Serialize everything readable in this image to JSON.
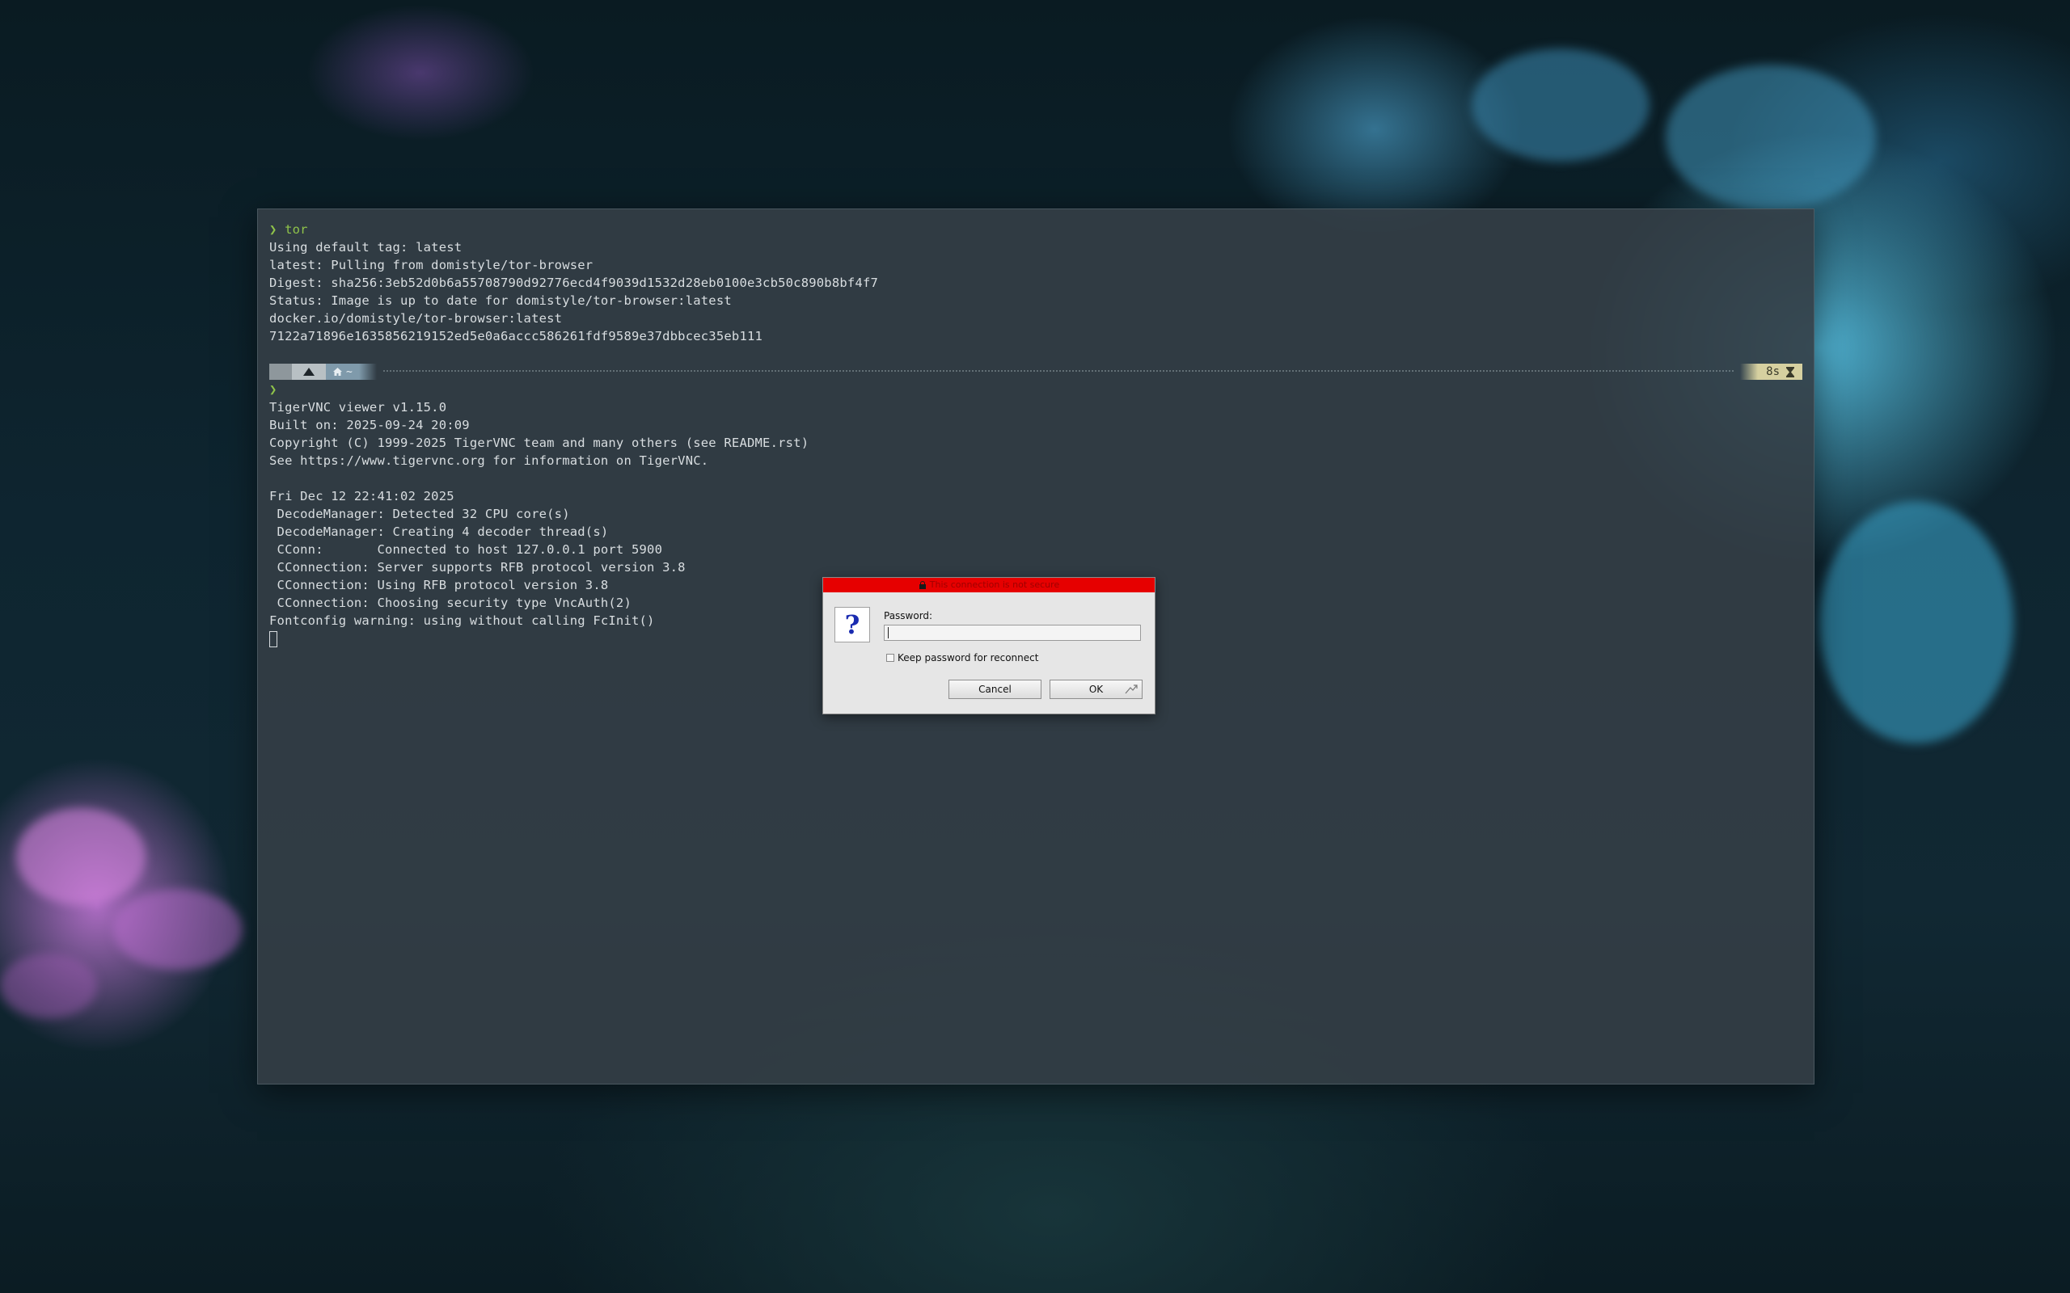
{
  "terminal": {
    "block1": [
      {
        "prompt": "❯",
        "command": "tor"
      },
      {
        "text": "Using default tag: latest"
      },
      {
        "text": "latest: Pulling from domistyle/tor-browser"
      },
      {
        "text": "Digest: sha256:3eb52d0b6a55708790d92776ecd4f9039d1532d28eb0100e3cb50c890b8bf4f7"
      },
      {
        "text": "Status: Image is up to date for domistyle/tor-browser:latest"
      },
      {
        "text": "docker.io/domistyle/tor-browser:latest"
      },
      {
        "text": "7122a71896e1635856219152ed5e0a6accc586261fdf9589e37dbbcec35eb111"
      }
    ],
    "status_bar": {
      "home_label": "~",
      "elapsed": "8s"
    },
    "block2": [
      {
        "prompt": "❯",
        "command": ""
      },
      {
        "text": "TigerVNC viewer v1.15.0"
      },
      {
        "text": "Built on: 2025-09-24 20:09"
      },
      {
        "text": "Copyright (C) 1999-2025 TigerVNC team and many others (see README.rst)"
      },
      {
        "text": "See https://www.tigervnc.org for information on TigerVNC."
      },
      {
        "text": ""
      },
      {
        "text": "Fri Dec 12 22:41:02 2025"
      },
      {
        "text": " DecodeManager: Detected 32 CPU core(s)"
      },
      {
        "text": " DecodeManager: Creating 4 decoder thread(s)"
      },
      {
        "text": " CConn:       Connected to host 127.0.0.1 port 5900"
      },
      {
        "text": " CConnection: Server supports RFB protocol version 3.8"
      },
      {
        "text": " CConnection: Using RFB protocol version 3.8"
      },
      {
        "text": " CConnection: Choosing security type VncAuth(2)"
      },
      {
        "text": "Fontconfig warning: using without calling FcInit()"
      }
    ]
  },
  "dialog": {
    "title": "This connection is not secure",
    "icon": "question-icon",
    "icon_glyph": "?",
    "password_label": "Password:",
    "password_value": "",
    "keep_password_label": "Keep password for reconnect",
    "keep_password_checked": false,
    "cancel_label": "Cancel",
    "ok_label": "OK"
  },
  "colors": {
    "terminal_bg": "#343e46",
    "prompt": "#8fc34a",
    "terminal_text": "#d8dde0",
    "dialog_title_bg": "#e60000",
    "dialog_bg": "#e6e6e6"
  }
}
